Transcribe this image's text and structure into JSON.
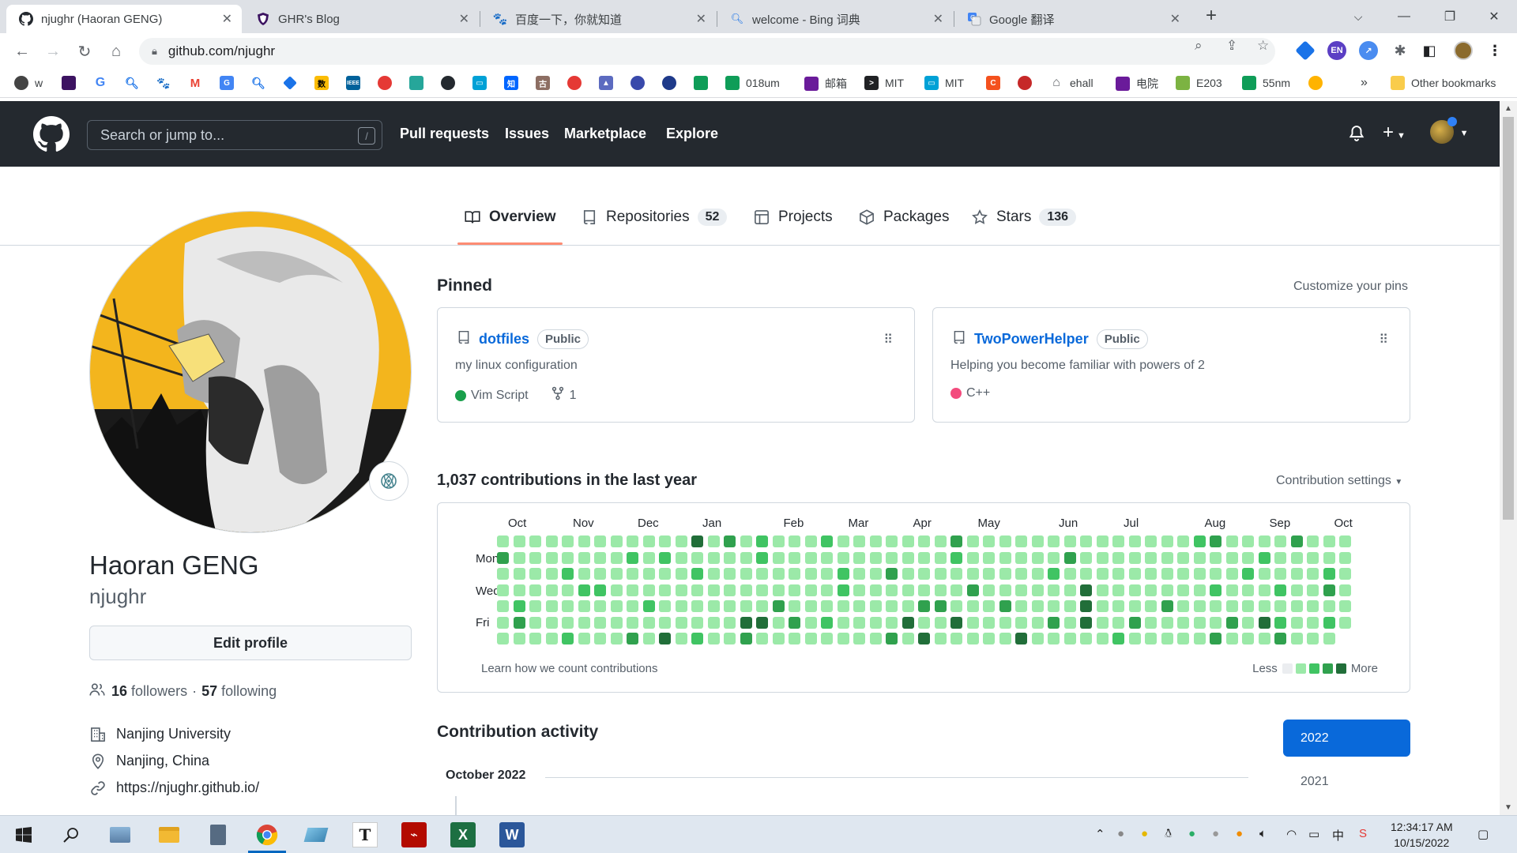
{
  "browser": {
    "tabs": [
      {
        "title": "njughr (Haoran GENG)",
        "icon": "github-icon",
        "active": true
      },
      {
        "title": "GHR's Blog",
        "icon": "shield-icon",
        "active": false
      },
      {
        "title": "百度一下，你就知道",
        "icon": "baidu-paw-icon",
        "active": false
      },
      {
        "title": "welcome - Bing 词典",
        "icon": "bing-search-icon",
        "active": false
      },
      {
        "title": "Google 翻译",
        "icon": "google-translate-icon",
        "active": false
      }
    ],
    "url": "github.com/njughr",
    "bookmarks": [
      "w",
      "018um",
      "邮箱",
      "MIT",
      "MIT",
      "ehall",
      "电院",
      "E203",
      "55nm"
    ],
    "other_bookmarks": "Other bookmarks",
    "overflow": "»"
  },
  "github": {
    "search_placeholder": "Search or jump to...",
    "search_key": "/",
    "nav": [
      "Pull requests",
      "Issues",
      "Marketplace",
      "Explore"
    ],
    "tabs": [
      {
        "label": "Overview",
        "count": null,
        "selected": true
      },
      {
        "label": "Repositories",
        "count": "52"
      },
      {
        "label": "Projects",
        "count": null
      },
      {
        "label": "Packages",
        "count": null
      },
      {
        "label": "Stars",
        "count": "136"
      }
    ],
    "accent": "#fd8c73",
    "link_color": "#0969da"
  },
  "profile": {
    "name": "Haoran GENG",
    "login": "njughr",
    "edit_label": "Edit profile",
    "followers_count": "16",
    "followers_label": "followers",
    "separator": "·",
    "following_count": "57",
    "following_label": "following",
    "organization": "Nanjing University",
    "location": "Nanjing, China",
    "website": "https://njughr.github.io/"
  },
  "pinned": {
    "heading": "Pinned",
    "customize": "Customize your pins",
    "repos": [
      {
        "name": "dotfiles",
        "visibility": "Public",
        "description": "my linux configuration",
        "language": "Vim Script",
        "lang_color": "#199f4b",
        "forks": "1"
      },
      {
        "name": "TwoPowerHelper",
        "visibility": "Public",
        "description": "Helping you become familiar with powers of 2",
        "language": "C++",
        "lang_color": "#f34b7d",
        "forks": null
      }
    ]
  },
  "contributions": {
    "heading": "1,037 contributions in the last year",
    "settings": "Contribution settings",
    "months": [
      "Oct",
      "Nov",
      "Dec",
      "Jan",
      "Feb",
      "Mar",
      "Apr",
      "May",
      "Jun",
      "Jul",
      "Aug",
      "Sep",
      "Oct"
    ],
    "days": [
      "Mon",
      "Wed",
      "Fri"
    ],
    "learn": "Learn how we count contributions",
    "less": "Less",
    "more": "More",
    "levels": [
      "#ebedf0",
      "#9be9a8",
      "#40c463",
      "#30a14e",
      "#216e39"
    ]
  },
  "activity": {
    "heading": "Contribution activity",
    "month": "October 2022",
    "years": [
      "2022",
      "2021"
    ]
  },
  "taskbar": {
    "time": "12:34:17 AM",
    "date": "10/15/2022",
    "excel": "X",
    "word": "W",
    "typora": "T"
  }
}
